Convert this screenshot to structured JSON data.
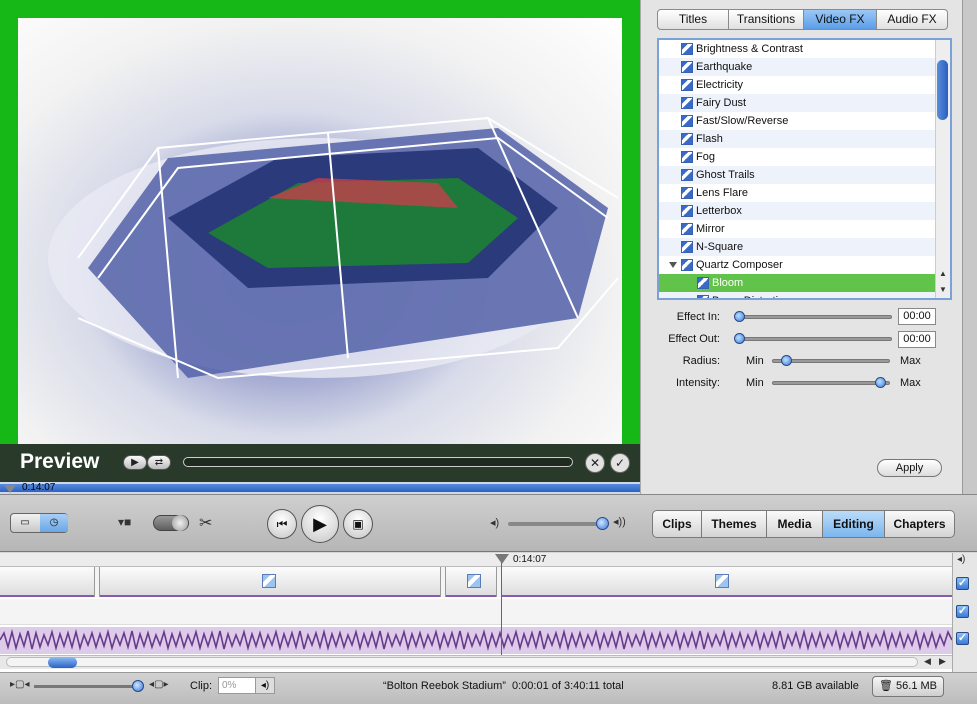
{
  "preview": {
    "label": "Preview",
    "scrub_time": "0:14:07"
  },
  "fx_tabs": [
    {
      "label": "Titles",
      "active": false
    },
    {
      "label": "Transitions",
      "active": false
    },
    {
      "label": "Video FX",
      "active": true
    },
    {
      "label": "Audio FX",
      "active": false
    }
  ],
  "effects": [
    {
      "label": "Brightness & Contrast"
    },
    {
      "label": "Earthquake"
    },
    {
      "label": "Electricity"
    },
    {
      "label": "Fairy Dust"
    },
    {
      "label": "Fast/Slow/Reverse"
    },
    {
      "label": "Flash"
    },
    {
      "label": "Fog"
    },
    {
      "label": "Ghost Trails"
    },
    {
      "label": "Lens Flare"
    },
    {
      "label": "Letterbox"
    },
    {
      "label": "Mirror"
    },
    {
      "label": "N-Square"
    },
    {
      "label": "Quartz Composer",
      "expanded": true
    },
    {
      "label": "Bloom",
      "selected": true,
      "child": true
    },
    {
      "label": "Bump Distortion",
      "child": true
    }
  ],
  "params": {
    "effect_in_label": "Effect In:",
    "effect_in_value": "00:00",
    "effect_out_label": "Effect Out:",
    "effect_out_value": "00:00",
    "radius_label": "Radius:",
    "intensity_label": "Intensity:",
    "min_label": "Min",
    "max_label": "Max",
    "radius_level": 0.12,
    "intensity_level": 0.92
  },
  "apply_label": "Apply",
  "pane_tabs": [
    {
      "label": "Clips",
      "active": false
    },
    {
      "label": "Themes",
      "active": false
    },
    {
      "label": "Media",
      "active": false
    },
    {
      "label": "Editing",
      "active": true
    },
    {
      "label": "Chapters",
      "active": false
    }
  ],
  "timeline": {
    "playhead_time": "0:14:07"
  },
  "status": {
    "clip_label": "Clip:",
    "clip_volume": "0%",
    "project_info": "“Bolton Reebok Stadium”  0:00:01 of 3:40:11 total",
    "disk_available": "8.81 GB available",
    "trash_size": "56.1 MB"
  },
  "colors": {
    "preview_border": "#16b818",
    "selected_row": "#62c34a",
    "active_tab": "#5a9ee8",
    "audio_wave": "#6a3a8a"
  },
  "icons": [
    "play-icon",
    "rewind-icon",
    "play-fullscreen-icon",
    "scissors-icon",
    "camera-icon",
    "volume-low-icon",
    "volume-high-icon",
    "trash-icon",
    "checkmark-icon",
    "close-icon",
    "loop-icon"
  ]
}
